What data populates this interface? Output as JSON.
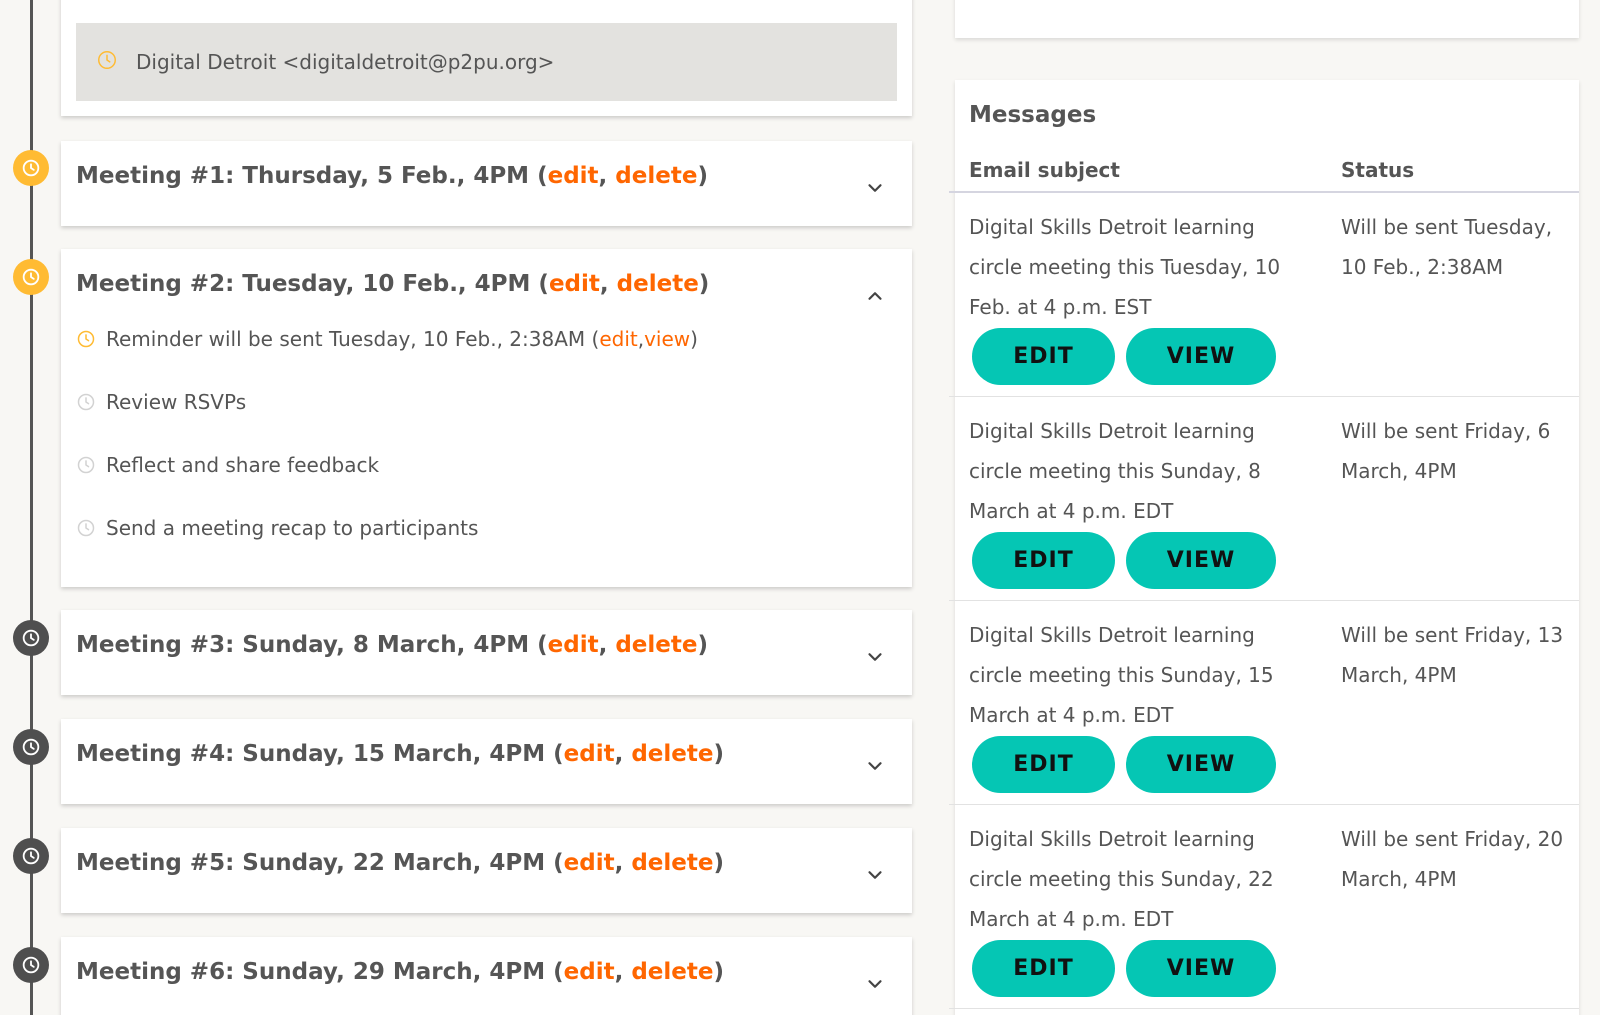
{
  "facilitator": {
    "contact": "Digital Detroit <digitaldetroit@p2pu.org>"
  },
  "meetings": [
    {
      "prefix": "Meeting #1: Thursday, 5 Feb., 4PM (",
      "edit": "edit",
      "sep": ", ",
      "delete": "delete",
      "suffix": ")"
    },
    {
      "prefix": "Meeting #2: Tuesday, 10 Feb., 4PM (",
      "edit": "edit",
      "sep": ", ",
      "delete": "delete",
      "suffix": ")"
    },
    {
      "prefix": "Meeting #3: Sunday, 8 March, 4PM (",
      "edit": "edit",
      "sep": ", ",
      "delete": "delete",
      "suffix": ")"
    },
    {
      "prefix": "Meeting #4: Sunday, 15 March, 4PM (",
      "edit": "edit",
      "sep": ", ",
      "delete": "delete",
      "suffix": ")"
    },
    {
      "prefix": "Meeting #5: Sunday, 22 March, 4PM (",
      "edit": "edit",
      "sep": ", ",
      "delete": "delete",
      "suffix": ")"
    },
    {
      "prefix": "Meeting #6: Sunday, 29 March, 4PM (",
      "edit": "edit",
      "sep": ", ",
      "delete": "delete",
      "suffix": ")"
    }
  ],
  "meeting2_tasks": {
    "reminder": {
      "prefix": "Reminder will be sent Tuesday, 10 Feb., 2:38AM (",
      "edit": "edit",
      "sep": ", ",
      "view": "view",
      "suffix": ")"
    },
    "review": "Review RSVPs",
    "reflect": "Reflect and share feedback",
    "recap": "Send a meeting recap to participants"
  },
  "messages": {
    "title": "Messages",
    "col_subject": "Email subject",
    "col_status": "Status",
    "rows": [
      {
        "subject": "Digital Skills Detroit learning circle meeting this Tuesday, 10 Feb. at 4 p.m. EST",
        "status": "Will be sent Tuesday, 10 Feb., 2:38AM",
        "edit": "EDIT",
        "view": "VIEW"
      },
      {
        "subject": "Digital Skills Detroit learning circle meeting this Sunday, 8 March at 4 p.m. EDT",
        "status": "Will be sent Friday, 6 March, 4PM",
        "edit": "EDIT",
        "view": "VIEW"
      },
      {
        "subject": "Digital Skills Detroit learning circle meeting this Sunday, 15 March at 4 p.m. EDT",
        "status": "Will be sent Friday, 13 March, 4PM",
        "edit": "EDIT",
        "view": "VIEW"
      },
      {
        "subject": "Digital Skills Detroit learning circle meeting this Sunday, 22 March at 4 p.m. EDT",
        "status": "Will be sent Friday, 20 March, 4PM",
        "edit": "EDIT",
        "view": "VIEW"
      }
    ]
  },
  "colors": {
    "accent_orange": "#ff6600",
    "teal_button": "#05c6b4",
    "timeline_future": "#ffbb33",
    "timeline_pending": "#4f4f4f"
  },
  "icons": {
    "timeline": "clock-icon",
    "expand": "chevron-down-icon",
    "collapse": "chevron-up-icon"
  }
}
